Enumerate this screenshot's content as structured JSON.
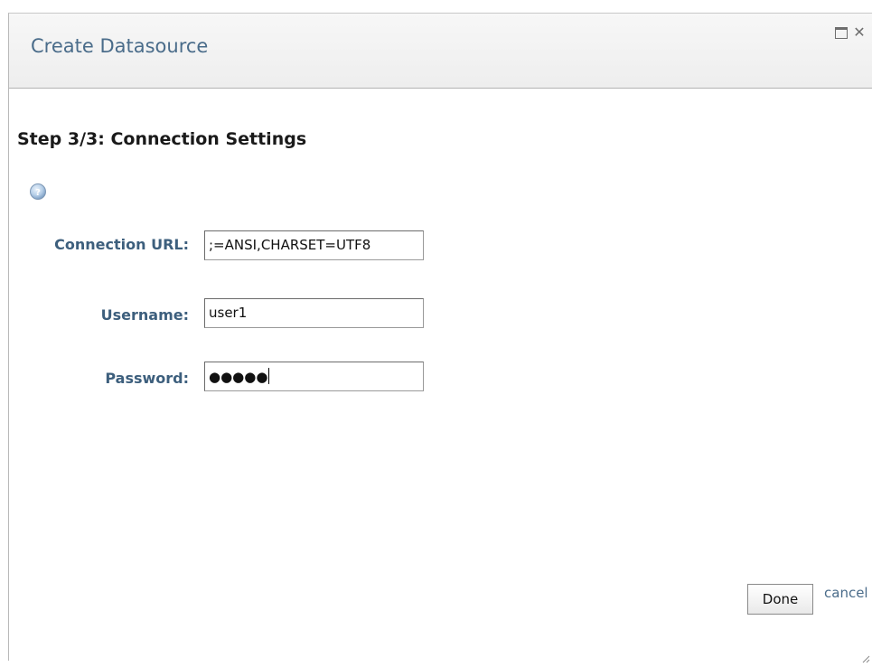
{
  "dialog": {
    "title": "Create Datasource",
    "step_title": "Step 3/3: Connection Settings"
  },
  "icons": {
    "help": "help-icon",
    "maximize": "maximize-icon",
    "close": "close-icon",
    "resize": "resize-grip-icon"
  },
  "form": {
    "connection_url": {
      "label": "Connection URL:",
      "value": ";=ANSI,CHARSET=UTF8"
    },
    "username": {
      "label": "Username:",
      "value": "user1"
    },
    "password": {
      "label": "Password:",
      "masked_value": "●●●●●"
    }
  },
  "actions": {
    "done_label": "Done",
    "cancel_label": "cancel"
  },
  "colors": {
    "title": "#4a6c8a",
    "label": "#3d5f7d"
  }
}
